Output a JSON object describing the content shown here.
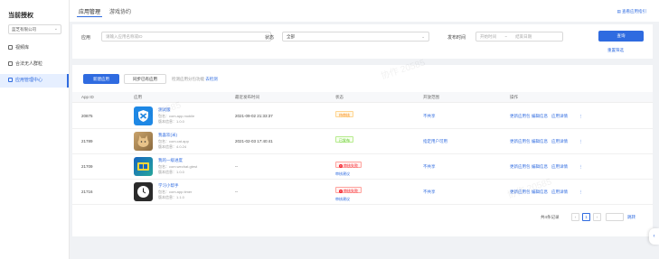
{
  "sidebar": {
    "title": "当前授权",
    "select_value": "蓝芝有限公司",
    "items": [
      {
        "label": "视频库"
      },
      {
        "label": "合法无人群粒"
      },
      {
        "label": "应用管理中心"
      }
    ]
  },
  "tabs": [
    {
      "label": "应用管理"
    },
    {
      "label": "游戏协约"
    }
  ],
  "top_link": "查看应用指引",
  "filter": {
    "app_label": "应用",
    "app_placeholder": "请输入应用名称或ID",
    "status_label": "状态",
    "status_value": "全部",
    "time_label": "发布时间",
    "time_start": "开始时间",
    "time_sep": "~",
    "time_end": "结束日期",
    "query_button": "查询",
    "reset_link": "重置筛选"
  },
  "toolbar": {
    "new_button": "新建应用",
    "sync_button": "同步已有应用",
    "hint": "检测应用分包功能",
    "hint_link": "去检测"
  },
  "table": {
    "columns": [
      "App ID",
      "应用",
      "最近发布时间",
      "状态",
      "开放范围",
      "操作"
    ],
    "rows": [
      {
        "id": "20875",
        "name": "测试版",
        "pkg": "包名：com.app.mobile",
        "ver": "版本信息：1.0.0",
        "time": "2021-09-02 21:33:37",
        "status": "待审核",
        "status_kind": "yellow",
        "sublink": "",
        "scope": "不共享",
        "icon": "shield-icon"
      },
      {
        "id": "21789",
        "name": "我喜欢(米)",
        "pkg": "包名：com.cat.app",
        "ver": "版本信息：4.0.24",
        "time": "2021-02-03 17:40:41",
        "status": "已发布",
        "status_kind": "green",
        "sublink": "",
        "scope": "指定用户可用",
        "icon": "cat-photo"
      },
      {
        "id": "21709",
        "name": "我的一级进度",
        "pkg": "包名：com.wechat.gtest",
        "ver": "版本信息：1.0.0",
        "time": "--",
        "status": "审核失败",
        "status_kind": "red",
        "sublink": "审核建议",
        "scope": "不共享",
        "icon": "study-icon"
      },
      {
        "id": "21716",
        "name": "学习小帮手",
        "pkg": "包名：com.app.timer",
        "ver": "版本信息：1.1.0",
        "time": "--",
        "status": "审核失败",
        "status_kind": "red",
        "sublink": "审核建议",
        "scope": "不共享",
        "icon": "clock-icon"
      }
    ],
    "actions": [
      "更新应用包",
      "编辑信息",
      "应用详情",
      "⋮"
    ]
  },
  "pagination": {
    "total": "共4条记录",
    "prev": "‹",
    "page": "1",
    "next": "›",
    "go": "跳转"
  },
  "watermark": "协作 20585",
  "colors": {
    "primary": "#2f6be0",
    "sidebar_active_bg": "#e6efff"
  }
}
